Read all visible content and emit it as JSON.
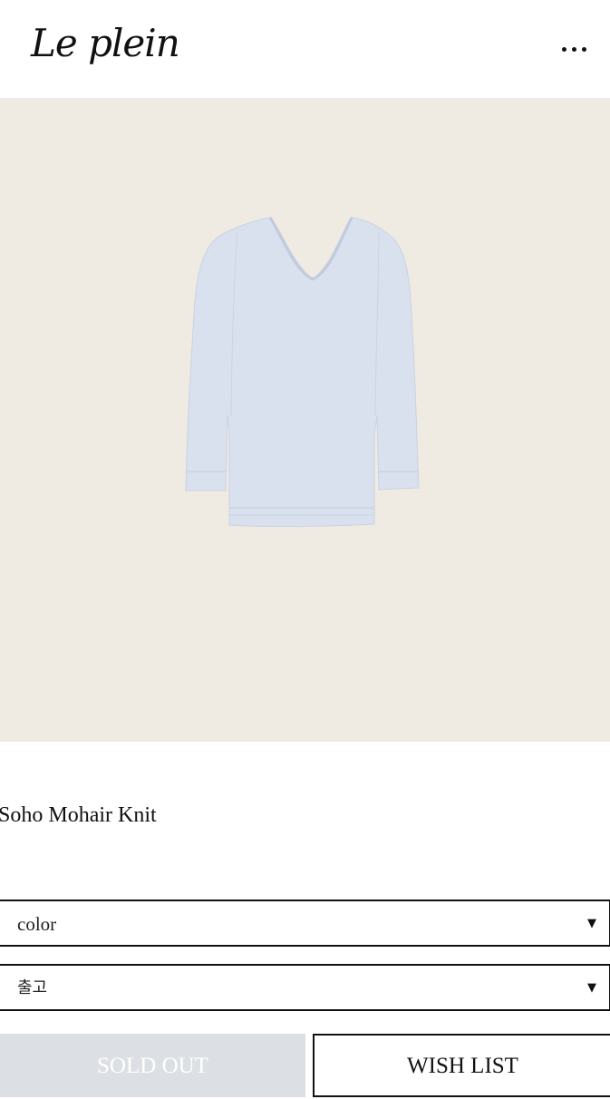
{
  "header": {
    "logo_text": "Le plein",
    "menu_icon": "more-dots-icon"
  },
  "product": {
    "image_alt_icon": "sweater-photo",
    "title": "Soho Mohair Knit"
  },
  "options": {
    "color_select": {
      "value": "color",
      "arrow": "▼"
    },
    "shipping_select": {
      "value": "출고",
      "arrow": "▼"
    }
  },
  "actions": {
    "sold_out_label": "SOLD OUT",
    "wish_list_label": "WISH LIST"
  },
  "colors": {
    "image_background": "#efebe3",
    "sweater": "#d9e1ef",
    "sold_out_background": "#dcdfe3"
  }
}
